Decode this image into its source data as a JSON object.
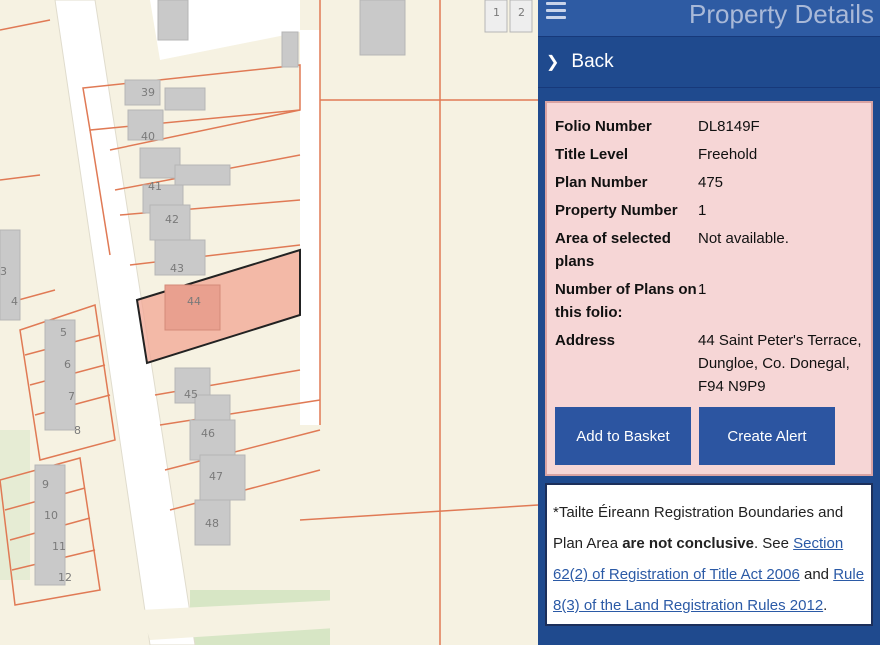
{
  "map": {
    "plot_numbers": [
      "1",
      "2",
      "3",
      "4",
      "5",
      "6",
      "7",
      "8",
      "9",
      "10",
      "11",
      "12",
      "39",
      "40",
      "41",
      "42",
      "43",
      "44",
      "45",
      "46",
      "47",
      "48"
    ],
    "selected_plot": "44",
    "colors": {
      "selected_fill": "#f2a593",
      "boundary": "#e07a55",
      "building": "#c8c8c8",
      "road": "#ffffff",
      "green": "#d7e6c5"
    }
  },
  "panel": {
    "title": "Property Details",
    "back_label": "Back",
    "details": [
      {
        "label": "Folio Number",
        "value": "DL8149F"
      },
      {
        "label": "Title Level",
        "value": "Freehold"
      },
      {
        "label": "Plan Number",
        "value": "475"
      },
      {
        "label": "Property Number",
        "value": "1"
      },
      {
        "label": "Area of selected plans",
        "value": "Not available."
      },
      {
        "label": "Number of Plans on this folio:",
        "value": "1"
      },
      {
        "label": "Address",
        "value": "44 Saint Peter's Terrace, Dungloe, Co. Donegal, F94 N9P9"
      }
    ],
    "add_to_basket": "Add to Basket",
    "create_alert": "Create Alert",
    "note": {
      "prefix": "*Tailte Éireann Registration Boundaries and Plan Area ",
      "bold": "are not conclusive",
      "mid1": ". See ",
      "link1": "Section 62(2) of Registration of Title Act 2006",
      "mid2": " and ",
      "link2": "Rule 8(3) of the Land Registration Rules 2012",
      "suffix": "."
    }
  }
}
